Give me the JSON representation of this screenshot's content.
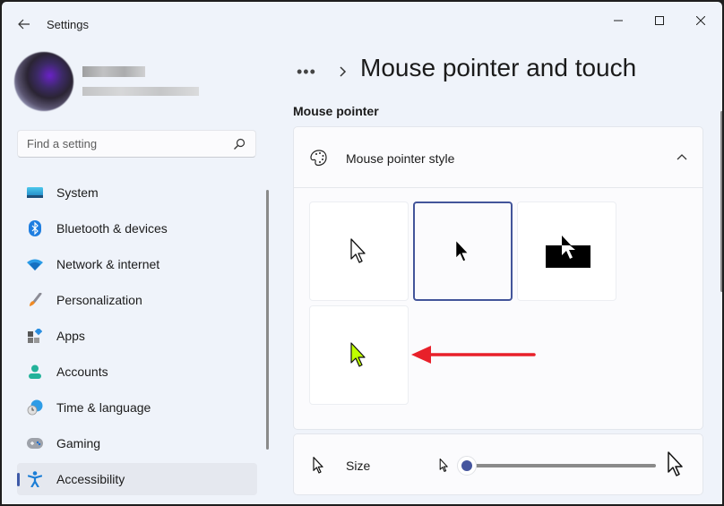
{
  "window": {
    "title": "Settings",
    "controls": {
      "minimize": "minimize",
      "maximize": "maximize",
      "close": "close"
    }
  },
  "profile": {
    "name": "[blurred name]",
    "email": "[blurred email]"
  },
  "search": {
    "placeholder": "Find a setting",
    "value": ""
  },
  "sidebar": {
    "items": [
      {
        "label": "System",
        "icon": "monitor-icon",
        "active": false
      },
      {
        "label": "Bluetooth & devices",
        "icon": "bluetooth-icon",
        "active": false
      },
      {
        "label": "Network & internet",
        "icon": "wifi-icon",
        "active": false
      },
      {
        "label": "Personalization",
        "icon": "paintbrush-icon",
        "active": false
      },
      {
        "label": "Apps",
        "icon": "apps-icon",
        "active": false
      },
      {
        "label": "Accounts",
        "icon": "person-icon",
        "active": false
      },
      {
        "label": "Time & language",
        "icon": "globe-clock-icon",
        "active": false
      },
      {
        "label": "Gaming",
        "icon": "gamepad-icon",
        "active": false
      },
      {
        "label": "Accessibility",
        "icon": "accessibility-icon",
        "active": true
      }
    ]
  },
  "main": {
    "breadcrumb_more": "•••",
    "page_title": "Mouse pointer and touch",
    "section_label": "Mouse pointer",
    "pointer_style": {
      "title": "Mouse pointer style",
      "expanded": true,
      "options": [
        {
          "name": "White",
          "selected": false
        },
        {
          "name": "Black",
          "selected": true
        },
        {
          "name": "Inverted",
          "selected": false
        },
        {
          "name": "Custom",
          "selected": false,
          "color": "#bfff00"
        }
      ]
    },
    "size": {
      "label": "Size",
      "value_fraction": 0.0
    },
    "annotation": {
      "type": "arrow",
      "color": "#e8202a",
      "points_to": "Custom"
    }
  }
}
